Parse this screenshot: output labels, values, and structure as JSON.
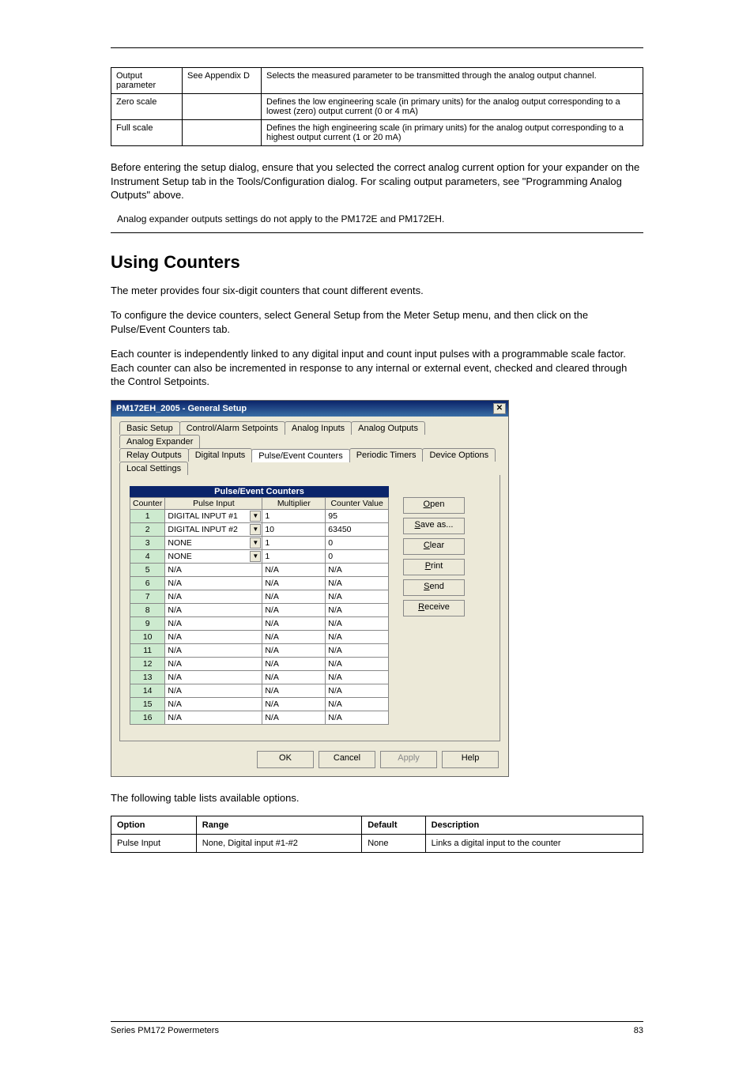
{
  "param_table": {
    "rows": [
      {
        "p": "Output parameter",
        "o": "See Appendix D",
        "d": "Selects the measured parameter to be transmitted through the analog output channel."
      },
      {
        "p": "Zero scale",
        "o": "",
        "d": "Defines the low engineering scale (in primary units) for the analog output corresponding to a lowest (zero) output current (0 or 4 mA)"
      },
      {
        "p": "Full scale",
        "o": "",
        "d": "Defines the high engineering scale (in primary units) for the analog output corresponding to a highest output current (1 or 20 mA)"
      }
    ]
  },
  "body1": "Before entering the setup dialog, ensure that you selected the correct analog current option for your expander on the Instrument Setup tab in the Tools/Configuration dialog. For scaling output parameters, see \"Programming Analog Outputs\" above.",
  "warn": "Analog expander outputs settings do not apply to the PM172E and PM172EH.",
  "h2": "Using Counters",
  "body2": "The meter provides four six-digit counters that count different events.",
  "body3": "To configure the device counters, select General Setup from the Meter Setup menu, and then click on the Pulse/Event Counters tab.",
  "body4": "Each counter is independently linked to any digital input and count input pulses with a programmable scale factor. Each counter can also be incremented in response to any internal or external event, checked and cleared through the Control Setpoints.",
  "dialog": {
    "title": "PM172EH_2005 - General Setup",
    "tabs_row1": [
      "Basic Setup",
      "Control/Alarm Setpoints",
      "Analog Inputs",
      "Analog Outputs",
      "Analog Expander"
    ],
    "tabs_row2": [
      "Relay Outputs",
      "Digital Inputs",
      "Pulse/Event Counters",
      "Periodic Timers",
      "Device Options",
      "Local Settings"
    ],
    "active_tab": "Pulse/Event Counters",
    "grid_title": "Pulse/Event Counters",
    "headers": [
      "Counter",
      "Pulse Input",
      "Multiplier",
      "Counter Value"
    ],
    "rows": [
      {
        "n": "1",
        "inp": "DIGITAL INPUT #1",
        "dd": true,
        "mul": "1",
        "val": "95"
      },
      {
        "n": "2",
        "inp": "DIGITAL INPUT #2",
        "dd": true,
        "mul": "10",
        "val": "63450"
      },
      {
        "n": "3",
        "inp": "NONE",
        "dd": true,
        "mul": "1",
        "val": "0"
      },
      {
        "n": "4",
        "inp": "NONE",
        "dd": true,
        "mul": "1",
        "val": "0"
      },
      {
        "n": "5",
        "inp": "N/A",
        "dd": false,
        "mul": "N/A",
        "val": "N/A"
      },
      {
        "n": "6",
        "inp": "N/A",
        "dd": false,
        "mul": "N/A",
        "val": "N/A"
      },
      {
        "n": "7",
        "inp": "N/A",
        "dd": false,
        "mul": "N/A",
        "val": "N/A"
      },
      {
        "n": "8",
        "inp": "N/A",
        "dd": false,
        "mul": "N/A",
        "val": "N/A"
      },
      {
        "n": "9",
        "inp": "N/A",
        "dd": false,
        "mul": "N/A",
        "val": "N/A"
      },
      {
        "n": "10",
        "inp": "N/A",
        "dd": false,
        "mul": "N/A",
        "val": "N/A"
      },
      {
        "n": "11",
        "inp": "N/A",
        "dd": false,
        "mul": "N/A",
        "val": "N/A"
      },
      {
        "n": "12",
        "inp": "N/A",
        "dd": false,
        "mul": "N/A",
        "val": "N/A"
      },
      {
        "n": "13",
        "inp": "N/A",
        "dd": false,
        "mul": "N/A",
        "val": "N/A"
      },
      {
        "n": "14",
        "inp": "N/A",
        "dd": false,
        "mul": "N/A",
        "val": "N/A"
      },
      {
        "n": "15",
        "inp": "N/A",
        "dd": false,
        "mul": "N/A",
        "val": "N/A"
      },
      {
        "n": "16",
        "inp": "N/A",
        "dd": false,
        "mul": "N/A",
        "val": "N/A"
      }
    ],
    "side_buttons": [
      {
        "pre": "",
        "u": "O",
        "post": "pen"
      },
      {
        "pre": "",
        "u": "S",
        "post": "ave as..."
      },
      {
        "pre": "",
        "u": "C",
        "post": "lear"
      },
      {
        "pre": "",
        "u": "P",
        "post": "rint"
      },
      {
        "pre": "",
        "u": "S",
        "post": "end"
      },
      {
        "pre": "",
        "u": "R",
        "post": "eceive"
      }
    ],
    "footer": {
      "ok": "OK",
      "cancel": "Cancel",
      "apply_pre": "",
      "apply_u": "A",
      "apply_post": "pply",
      "help": "Help"
    }
  },
  "body5": "The following table lists available options.",
  "opt_table": {
    "headers": [
      "Option",
      "Range",
      "Default",
      "Description"
    ],
    "rows": [
      [
        "Pulse Input",
        "None, Digital input #1-#2",
        "None",
        "Links a digital input to the counter"
      ]
    ]
  },
  "footer": {
    "left": "Series PM172 Powermeters",
    "right": "83"
  }
}
